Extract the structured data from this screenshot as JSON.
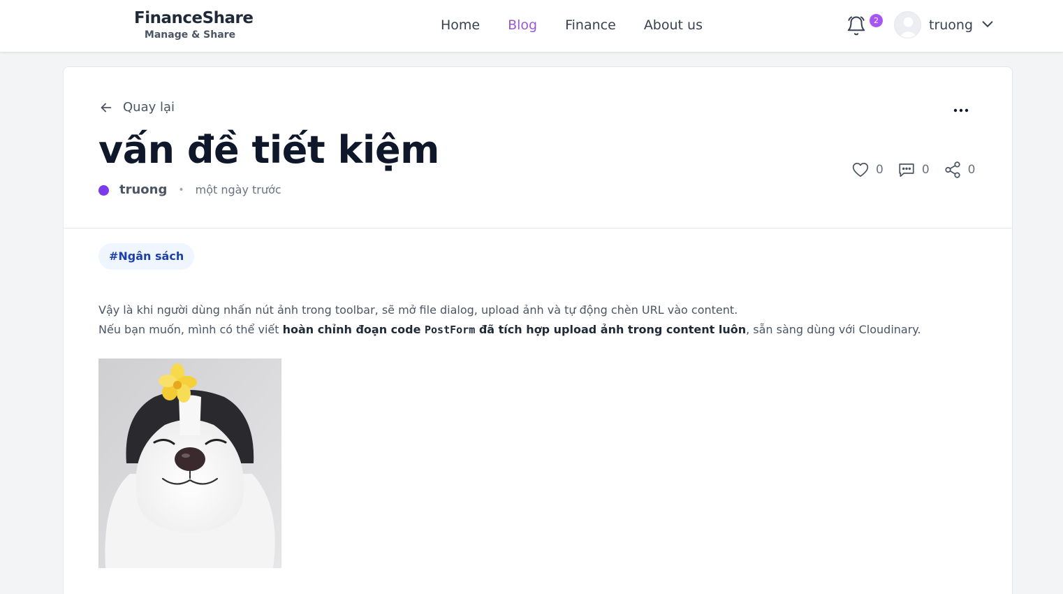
{
  "brand": {
    "title": "FinanceShare",
    "subtitle": "Manage & Share"
  },
  "nav": {
    "links": [
      "Home",
      "Blog",
      "Finance",
      "About us"
    ],
    "active": "Blog"
  },
  "header": {
    "notification_count": "2",
    "username": "truong"
  },
  "post": {
    "back_label": "Quay lại",
    "title": "vấn đề tiết kiệm",
    "author": "truong",
    "time": "một ngày trước",
    "likes": "0",
    "comments": "0",
    "shares": "0",
    "tag": "#Ngân sách",
    "content": {
      "line1": "Vậy là khi người dùng nhấn nút ảnh trong toolbar, sẽ mở file dialog, upload ảnh và tự động chèn URL vào content.",
      "line2_prefix": "Nếu bạn muốn, mình có thể viết ",
      "line2_bold_a": "hoàn chỉnh đoạn code ",
      "line2_code": "PostForm",
      "line2_bold_b": " đã tích hợp upload ảnh trong content luôn",
      "line2_suffix": ", sẵn sàng dùng với Cloudinary."
    }
  },
  "colors": {
    "accent": "#9b59d0",
    "badge": "#a855f7",
    "author_dot": "#7c3aed",
    "tag_bg": "#eff6ff",
    "tag_text": "#1e40af"
  }
}
